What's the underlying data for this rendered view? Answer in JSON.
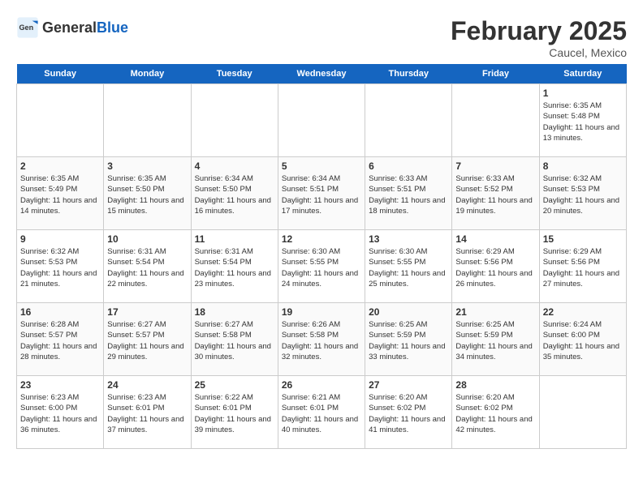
{
  "header": {
    "logo": {
      "text_general": "General",
      "text_blue": "Blue"
    },
    "title": "February 2025",
    "location": "Caucel, Mexico"
  },
  "days_of_week": [
    "Sunday",
    "Monday",
    "Tuesday",
    "Wednesday",
    "Thursday",
    "Friday",
    "Saturday"
  ],
  "weeks": [
    {
      "cells": [
        {
          "day": null,
          "info": null
        },
        {
          "day": null,
          "info": null
        },
        {
          "day": null,
          "info": null
        },
        {
          "day": null,
          "info": null
        },
        {
          "day": null,
          "info": null
        },
        {
          "day": null,
          "info": null
        },
        {
          "day": "1",
          "info": "Sunrise: 6:35 AM\nSunset: 5:48 PM\nDaylight: 11 hours and 13 minutes."
        }
      ]
    },
    {
      "cells": [
        {
          "day": "2",
          "info": "Sunrise: 6:35 AM\nSunset: 5:49 PM\nDaylight: 11 hours and 14 minutes."
        },
        {
          "day": "3",
          "info": "Sunrise: 6:35 AM\nSunset: 5:50 PM\nDaylight: 11 hours and 15 minutes."
        },
        {
          "day": "4",
          "info": "Sunrise: 6:34 AM\nSunset: 5:50 PM\nDaylight: 11 hours and 16 minutes."
        },
        {
          "day": "5",
          "info": "Sunrise: 6:34 AM\nSunset: 5:51 PM\nDaylight: 11 hours and 17 minutes."
        },
        {
          "day": "6",
          "info": "Sunrise: 6:33 AM\nSunset: 5:51 PM\nDaylight: 11 hours and 18 minutes."
        },
        {
          "day": "7",
          "info": "Sunrise: 6:33 AM\nSunset: 5:52 PM\nDaylight: 11 hours and 19 minutes."
        },
        {
          "day": "8",
          "info": "Sunrise: 6:32 AM\nSunset: 5:53 PM\nDaylight: 11 hours and 20 minutes."
        }
      ]
    },
    {
      "cells": [
        {
          "day": "9",
          "info": "Sunrise: 6:32 AM\nSunset: 5:53 PM\nDaylight: 11 hours and 21 minutes."
        },
        {
          "day": "10",
          "info": "Sunrise: 6:31 AM\nSunset: 5:54 PM\nDaylight: 11 hours and 22 minutes."
        },
        {
          "day": "11",
          "info": "Sunrise: 6:31 AM\nSunset: 5:54 PM\nDaylight: 11 hours and 23 minutes."
        },
        {
          "day": "12",
          "info": "Sunrise: 6:30 AM\nSunset: 5:55 PM\nDaylight: 11 hours and 24 minutes."
        },
        {
          "day": "13",
          "info": "Sunrise: 6:30 AM\nSunset: 5:55 PM\nDaylight: 11 hours and 25 minutes."
        },
        {
          "day": "14",
          "info": "Sunrise: 6:29 AM\nSunset: 5:56 PM\nDaylight: 11 hours and 26 minutes."
        },
        {
          "day": "15",
          "info": "Sunrise: 6:29 AM\nSunset: 5:56 PM\nDaylight: 11 hours and 27 minutes."
        }
      ]
    },
    {
      "cells": [
        {
          "day": "16",
          "info": "Sunrise: 6:28 AM\nSunset: 5:57 PM\nDaylight: 11 hours and 28 minutes."
        },
        {
          "day": "17",
          "info": "Sunrise: 6:27 AM\nSunset: 5:57 PM\nDaylight: 11 hours and 29 minutes."
        },
        {
          "day": "18",
          "info": "Sunrise: 6:27 AM\nSunset: 5:58 PM\nDaylight: 11 hours and 30 minutes."
        },
        {
          "day": "19",
          "info": "Sunrise: 6:26 AM\nSunset: 5:58 PM\nDaylight: 11 hours and 32 minutes."
        },
        {
          "day": "20",
          "info": "Sunrise: 6:25 AM\nSunset: 5:59 PM\nDaylight: 11 hours and 33 minutes."
        },
        {
          "day": "21",
          "info": "Sunrise: 6:25 AM\nSunset: 5:59 PM\nDaylight: 11 hours and 34 minutes."
        },
        {
          "day": "22",
          "info": "Sunrise: 6:24 AM\nSunset: 6:00 PM\nDaylight: 11 hours and 35 minutes."
        }
      ]
    },
    {
      "cells": [
        {
          "day": "23",
          "info": "Sunrise: 6:23 AM\nSunset: 6:00 PM\nDaylight: 11 hours and 36 minutes."
        },
        {
          "day": "24",
          "info": "Sunrise: 6:23 AM\nSunset: 6:01 PM\nDaylight: 11 hours and 37 minutes."
        },
        {
          "day": "25",
          "info": "Sunrise: 6:22 AM\nSunset: 6:01 PM\nDaylight: 11 hours and 39 minutes."
        },
        {
          "day": "26",
          "info": "Sunrise: 6:21 AM\nSunset: 6:01 PM\nDaylight: 11 hours and 40 minutes."
        },
        {
          "day": "27",
          "info": "Sunrise: 6:20 AM\nSunset: 6:02 PM\nDaylight: 11 hours and 41 minutes."
        },
        {
          "day": "28",
          "info": "Sunrise: 6:20 AM\nSunset: 6:02 PM\nDaylight: 11 hours and 42 minutes."
        },
        {
          "day": null,
          "info": null
        }
      ]
    }
  ]
}
